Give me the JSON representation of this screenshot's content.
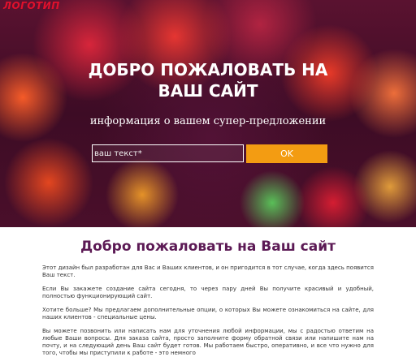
{
  "header": {
    "logo": "ЛОГОТИП"
  },
  "hero": {
    "title_line1": "ДОБРО ПОЖАЛОВАТЬ НА",
    "title_line2": "ВАШ САЙТ",
    "subtitle": "информация о вашем супер-предложении",
    "input_placeholder": "ваш текст*",
    "ok_label": "OK"
  },
  "main": {
    "title": "Добро пожаловать на Ваш сайт",
    "paragraphs": [
      "Этот дизайн был разработан для Вас и Ваших клиентов, и он пригодится в тот случае, когда здесь появится Ваш текст.",
      "Если Вы закажете создание сайта сегодня, то через пару дней Вы получите красивый и удобный, полностью функционирующий сайт.",
      "Хотите больше? Мы предлагаем дополнительные опции, о которых Вы можете ознакомиться на сайте, для наших клиентов - специальные цены.",
      "Вы можете позвонить или написать нам для уточнения любой информации, мы с радостью ответим на любые Ваши вопросы. Для заказа сайта, просто заполните форму обратной связи или напишите нам на почту, и на следующий день Ваш сайт будет готов. Мы работаем быстро, оперативно, и все что нужно для того, чтобы мы приступили к работе - это немного"
    ]
  },
  "colors": {
    "logo": "#e0102c",
    "ok_button": "#f39c12",
    "section_title": "#5c1a55"
  }
}
